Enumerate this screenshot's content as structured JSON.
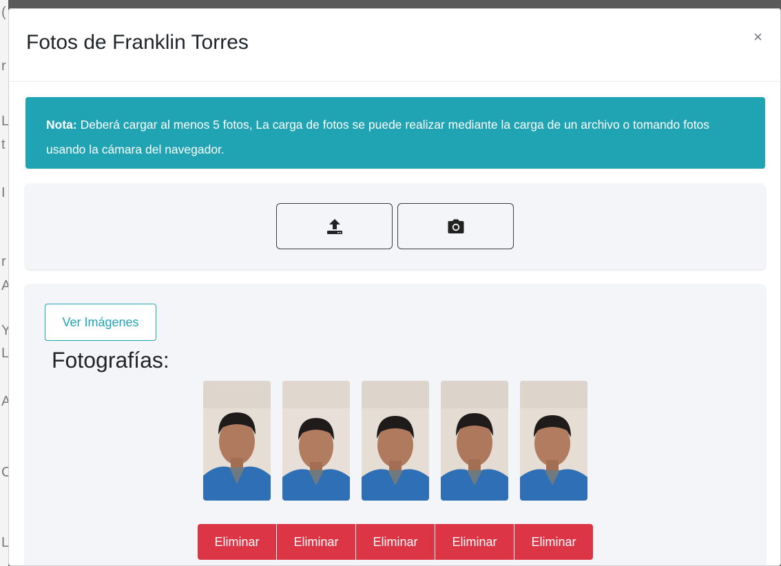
{
  "modal": {
    "title": "Fotos de Franklin Torres",
    "close_label": "×"
  },
  "note": {
    "label": "Nota:",
    "text": " Deberá cargar al menos 5 fotos, La carga de fotos se puede realizar mediante la carga de un archivo o tomando fotos usando la cámara del navegador."
  },
  "upload": {
    "upload_icon": "upload-icon",
    "camera_icon": "camera-icon"
  },
  "photos": {
    "view_button": "Ver Imágenes",
    "section_title": "Fotografías:",
    "items": [
      {
        "alt": "",
        "delete_label": "Eliminar"
      },
      {
        "alt": "",
        "delete_label": "Eliminar"
      },
      {
        "alt": "",
        "delete_label": "Eliminar"
      },
      {
        "alt": "",
        "delete_label": "Eliminar"
      },
      {
        "alt": "",
        "delete_label": "Eliminar"
      }
    ]
  },
  "colors": {
    "info": "#20a4b4",
    "danger": "#dc3545",
    "card_bg": "#f3f5f8"
  }
}
